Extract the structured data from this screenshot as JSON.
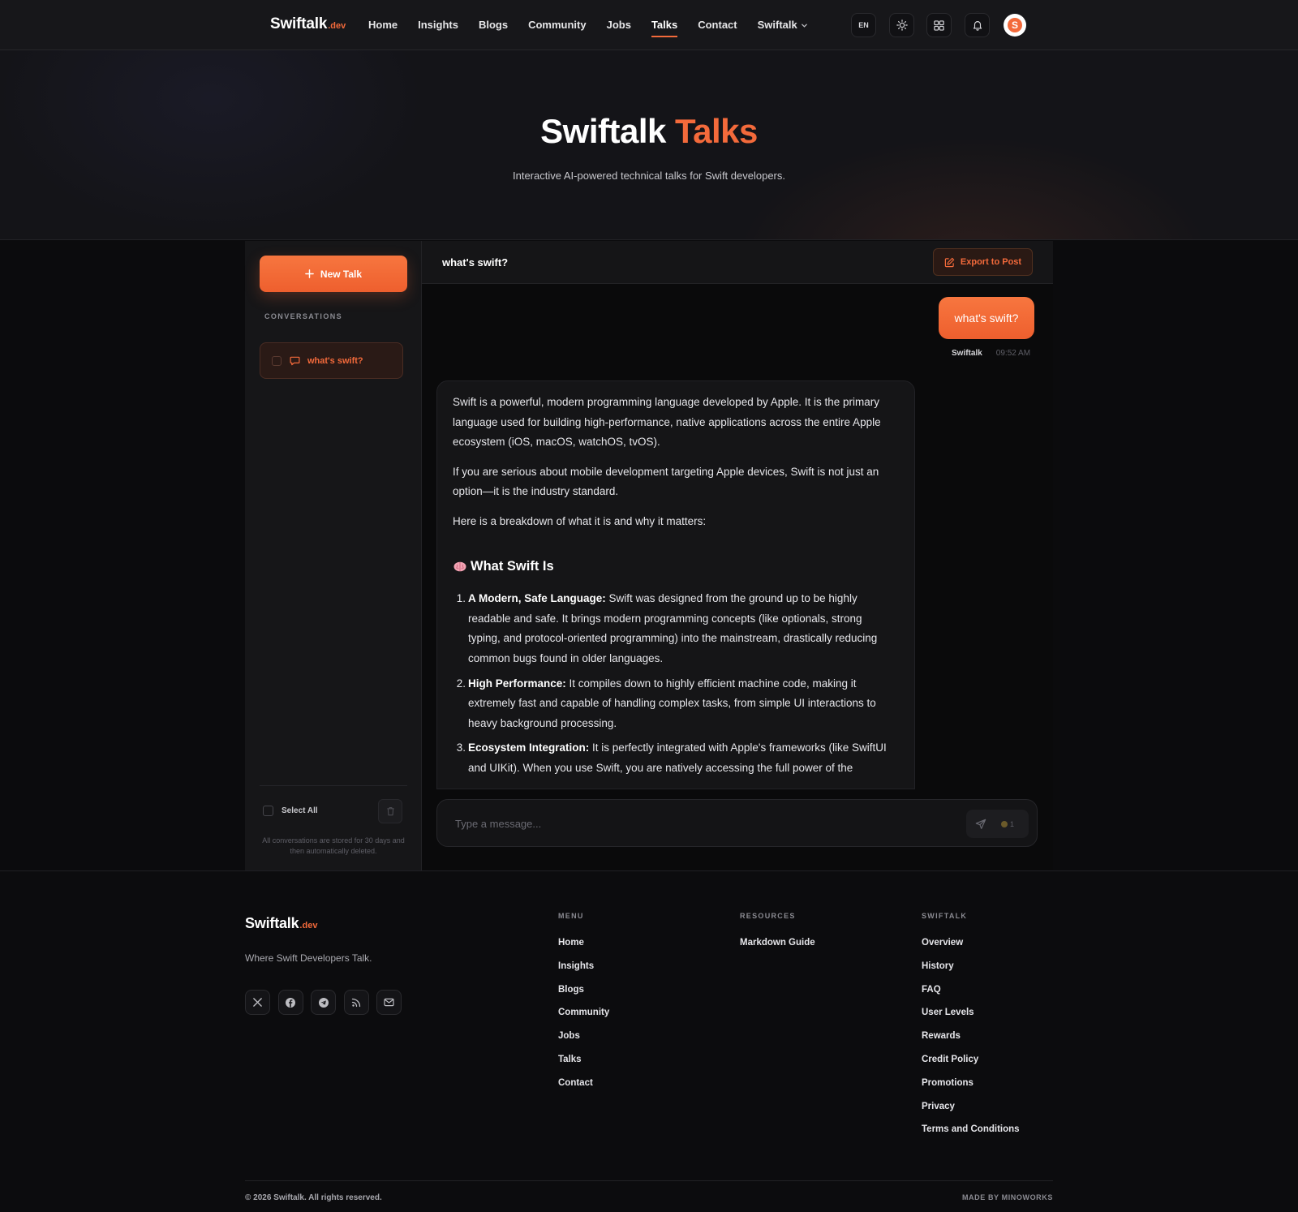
{
  "brand": {
    "name": "Swiftalk",
    "tld": ".dev"
  },
  "nav": {
    "items": [
      {
        "label": "Home"
      },
      {
        "label": "Insights"
      },
      {
        "label": "Blogs"
      },
      {
        "label": "Community"
      },
      {
        "label": "Jobs"
      },
      {
        "label": "Talks",
        "active": true
      },
      {
        "label": "Contact"
      },
      {
        "label": "Swiftalk",
        "dropdown": true
      }
    ]
  },
  "header_actions": {
    "lang": "EN",
    "icons": [
      "sun-icon",
      "grid-icon",
      "bell-icon"
    ],
    "avatar_letter": "S"
  },
  "hero": {
    "title_main": "Swiftalk",
    "title_accent": "Talks",
    "subtitle": "Interactive AI-powered technical talks for Swift developers."
  },
  "sidebar": {
    "new_talk": "New Talk",
    "section_label": "CONVERSATIONS",
    "conversations": [
      {
        "title": "what's swift?",
        "active": true
      }
    ],
    "select_all": "Select All",
    "note": "All conversations are stored for 30 days and then automatically deleted."
  },
  "chat": {
    "title": "what's swift?",
    "export_label": "Export to Post",
    "user_message": "what's swift?",
    "user_name": "Swiftalk",
    "time": "09:52 AM",
    "ai": {
      "p1": "Swift is a powerful, modern programming language developed by Apple. It is the primary language used for building high-performance, native applications across the entire Apple ecosystem (iOS, macOS, watchOS, tvOS).",
      "p2": "If you are serious about mobile development targeting Apple devices, Swift is not just an option—it is the industry standard.",
      "p3": "Here is a breakdown of what it is and why it matters:",
      "heading": "What Swift Is",
      "list": [
        {
          "num": "1.",
          "bold": "A Modern, Safe Language:",
          "text": " Swift was designed from the ground up to be highly readable and safe. It brings modern programming concepts (like optionals, strong typing, and protocol-oriented programming) into the mainstream, drastically reducing common bugs found in older languages."
        },
        {
          "num": "2.",
          "bold": "High Performance:",
          "text": " It compiles down to highly efficient machine code, making it extremely fast and capable of handling complex tasks, from simple UI interactions to heavy background processing."
        },
        {
          "num": "3.",
          "bold": "Ecosystem Integration:",
          "text": " It is perfectly integrated with Apple's frameworks (like SwiftUI and UIKit). When you use Swift, you are natively accessing the full power of the"
        }
      ]
    },
    "input_placeholder": "Type a message...",
    "credits": "1"
  },
  "footer": {
    "tagline": "Where Swift Developers Talk.",
    "socials": [
      "x-icon",
      "facebook-icon",
      "telegram-icon",
      "rss-icon",
      "mail-icon"
    ],
    "menu_title": "MENU",
    "menu": [
      "Home",
      "Insights",
      "Blogs",
      "Community",
      "Jobs",
      "Talks",
      "Contact"
    ],
    "resources_title": "RESOURCES",
    "resources": [
      "Markdown Guide"
    ],
    "swiftalk_title": "SWIFTALK",
    "swiftalk": [
      "Overview",
      "History",
      "FAQ",
      "User Levels",
      "Rewards",
      "Credit Policy",
      "Promotions",
      "Privacy",
      "Terms and Conditions"
    ],
    "copyright": "© 2026 Swiftalk. All rights reserved.",
    "made_by": "MADE BY MINOWORKS"
  },
  "colors": {
    "accent": "#f36a3b",
    "bg": "#0b0b0d",
    "surface": "#161618"
  }
}
